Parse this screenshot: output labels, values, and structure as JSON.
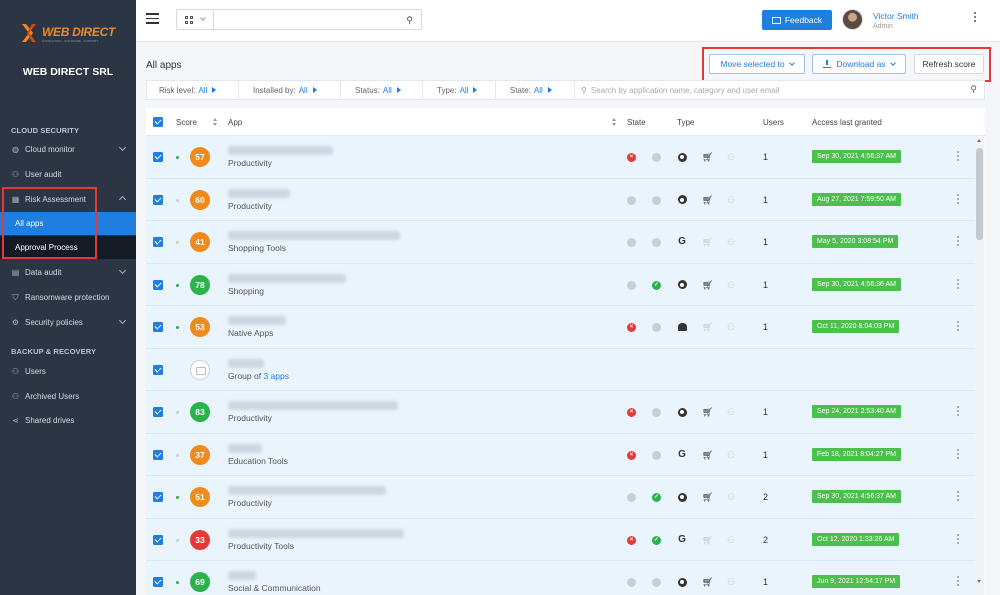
{
  "brand": {
    "logo_text": "WEB DIRECT",
    "logo_sub": "CONSULTING · SOFTWARE · SUPPORT",
    "company": "WEB DIRECT SRL",
    "accent": "#1f7fe0"
  },
  "sidebar": {
    "section_cloud": "CLOUD SECURITY",
    "cloud_monitor": "Cloud monitor",
    "user_audit": "User audit",
    "risk_assessment": "Risk Assessment",
    "all_apps": "All apps",
    "approval_process": "Approval Process",
    "data_audit": "Data audit",
    "ransomware": "Ransomware protection",
    "security_policies": "Security policies",
    "section_backup": "BACKUP & RECOVERY",
    "users": "Users",
    "archived_users": "Archived Users",
    "shared_drives": "Shared drives"
  },
  "topbar": {
    "feedback": "Feedback",
    "user_name": "Victor Smith",
    "user_role": "Admin"
  },
  "toolbar": {
    "title": "All apps",
    "move_selected": "Move selected to",
    "download_as": "Download as",
    "refresh": "Refresh score"
  },
  "filters": [
    {
      "label": "Risk level:",
      "value": "All"
    },
    {
      "label": "Installed by:",
      "value": "All"
    },
    {
      "label": "Status:",
      "value": "All"
    },
    {
      "label": "Type:",
      "value": "All"
    },
    {
      "label": "State:",
      "value": "All"
    }
  ],
  "search": {
    "placeholder": "Search by application name, category and user email"
  },
  "table": {
    "headers": {
      "score": "Score",
      "app": "App",
      "state": "State",
      "type": "Type",
      "users": "Users",
      "access": "Access last granted"
    },
    "rows": [
      {
        "score": "57",
        "color": "#f08a1c",
        "category": "Productivity",
        "users": "1",
        "access": "Sep 30, 2021 4:56:37 AM",
        "active": true
      },
      {
        "score": "60",
        "color": "#f08a1c",
        "category": "Productivity",
        "users": "1",
        "access": "Aug 27, 2021 7:59:50 AM",
        "active": false
      },
      {
        "score": "41",
        "color": "#f08a1c",
        "category": "Shopping Tools",
        "users": "1",
        "access": "May 5, 2020 3:08:54 PM",
        "active": false
      },
      {
        "score": "78",
        "color": "#2ab24b",
        "category": "Shopping",
        "users": "1",
        "access": "Sep 30, 2021 4:56:36 AM",
        "active": true
      },
      {
        "score": "53",
        "color": "#f08a1c",
        "category": "Native Apps",
        "users": "1",
        "access": "Oct 11, 2020 8:04:03 PM",
        "active": true
      },
      {
        "score": "",
        "color": "",
        "category": "Group of",
        "group_link": "3 apps",
        "users": "",
        "access": "",
        "active": false
      },
      {
        "score": "83",
        "color": "#2ab24b",
        "category": "Productivity",
        "users": "1",
        "access": "Sep 24, 2021 2:53:40 AM",
        "active": true
      },
      {
        "score": "37",
        "color": "#f08a1c",
        "category": "Education Tools",
        "users": "1",
        "access": "Feb 18, 2021 8:04:27 PM",
        "active": false
      },
      {
        "score": "51",
        "color": "#f08a1c",
        "category": "Productivity",
        "users": "2",
        "access": "Sep 30, 2021 4:56:37 AM",
        "active": true
      },
      {
        "score": "33",
        "color": "#e53935",
        "category": "Productivity Tools",
        "users": "2",
        "access": "Oct 12, 2020 1:33:26 AM",
        "active": false
      },
      {
        "score": "69",
        "color": "#2ab24b",
        "category": "Social & Communication",
        "users": "1",
        "access": "Jun 9, 2021 12:54:17 PM",
        "active": true
      }
    ]
  }
}
